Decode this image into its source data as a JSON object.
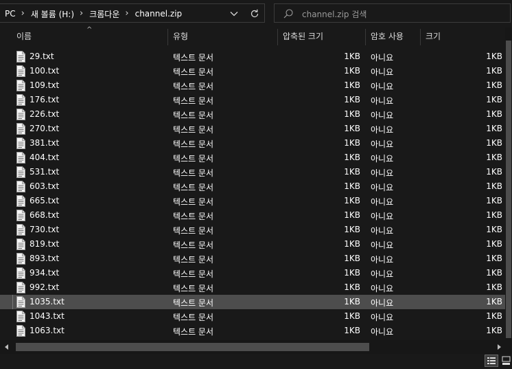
{
  "address_bar": {
    "crumbs": [
      "PC",
      "새 볼륨 (H:)",
      "크롬다운",
      "channel.zip"
    ]
  },
  "search": {
    "placeholder": "channel.zip 검색"
  },
  "columns": {
    "name": "이름",
    "type": "유형",
    "compressed_size": "압축된 크기",
    "password": "암호 사용",
    "size": "크기"
  },
  "files": [
    {
      "name": "29.txt",
      "type": "텍스트 문서",
      "csize": "1KB",
      "enc": "아니요",
      "size": "1KB"
    },
    {
      "name": "100.txt",
      "type": "텍스트 문서",
      "csize": "1KB",
      "enc": "아니요",
      "size": "1KB"
    },
    {
      "name": "109.txt",
      "type": "텍스트 문서",
      "csize": "1KB",
      "enc": "아니요",
      "size": "1KB"
    },
    {
      "name": "176.txt",
      "type": "텍스트 문서",
      "csize": "1KB",
      "enc": "아니요",
      "size": "1KB"
    },
    {
      "name": "226.txt",
      "type": "텍스트 문서",
      "csize": "1KB",
      "enc": "아니요",
      "size": "1KB"
    },
    {
      "name": "270.txt",
      "type": "텍스트 문서",
      "csize": "1KB",
      "enc": "아니요",
      "size": "1KB"
    },
    {
      "name": "381.txt",
      "type": "텍스트 문서",
      "csize": "1KB",
      "enc": "아니요",
      "size": "1KB"
    },
    {
      "name": "404.txt",
      "type": "텍스트 문서",
      "csize": "1KB",
      "enc": "아니요",
      "size": "1KB"
    },
    {
      "name": "531.txt",
      "type": "텍스트 문서",
      "csize": "1KB",
      "enc": "아니요",
      "size": "1KB"
    },
    {
      "name": "603.txt",
      "type": "텍스트 문서",
      "csize": "1KB",
      "enc": "아니요",
      "size": "1KB"
    },
    {
      "name": "665.txt",
      "type": "텍스트 문서",
      "csize": "1KB",
      "enc": "아니요",
      "size": "1KB"
    },
    {
      "name": "668.txt",
      "type": "텍스트 문서",
      "csize": "1KB",
      "enc": "아니요",
      "size": "1KB"
    },
    {
      "name": "730.txt",
      "type": "텍스트 문서",
      "csize": "1KB",
      "enc": "아니요",
      "size": "1KB"
    },
    {
      "name": "819.txt",
      "type": "텍스트 문서",
      "csize": "1KB",
      "enc": "아니요",
      "size": "1KB"
    },
    {
      "name": "893.txt",
      "type": "텍스트 문서",
      "csize": "1KB",
      "enc": "아니요",
      "size": "1KB"
    },
    {
      "name": "934.txt",
      "type": "텍스트 문서",
      "csize": "1KB",
      "enc": "아니요",
      "size": "1KB"
    },
    {
      "name": "992.txt",
      "type": "텍스트 문서",
      "csize": "1KB",
      "enc": "아니요",
      "size": "1KB"
    },
    {
      "name": "1035.txt",
      "type": "텍스트 문서",
      "csize": "1KB",
      "enc": "아니요",
      "size": "1KB",
      "selected": true
    },
    {
      "name": "1043.txt",
      "type": "텍스트 문서",
      "csize": "1KB",
      "enc": "아니요",
      "size": "1KB"
    },
    {
      "name": "1063.txt",
      "type": "텍스트 문서",
      "csize": "1KB",
      "enc": "아니요",
      "size": "1KB"
    }
  ],
  "icons": {
    "file": "text-file-icon",
    "search": "search-icon",
    "refresh": "refresh-icon",
    "dropdown": "chevron-down-icon",
    "breadcrumb_separator": "chevron-right-icon"
  },
  "colors": {
    "background": "#191919",
    "selected_row": "#4d4d4d",
    "text": "#ffffff",
    "placeholder": "#9a9a9a"
  }
}
